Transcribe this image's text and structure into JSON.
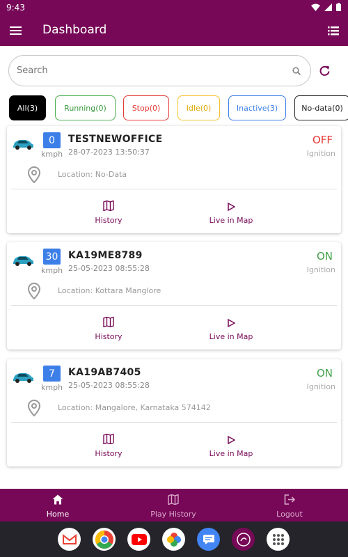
{
  "status": {
    "time": "9:43"
  },
  "appbar": {
    "title": "Dashboard"
  },
  "search": {
    "placeholder": "Search"
  },
  "filters": [
    {
      "label": "All(3)"
    },
    {
      "label": "Running(0)"
    },
    {
      "label": "Stop(0)"
    },
    {
      "label": "Idle(0)"
    },
    {
      "label": "Inactive(3)"
    },
    {
      "label": "No-data(0)"
    }
  ],
  "colors": {
    "brand": "#770857",
    "speed_badge": "#3d7fe8",
    "off": "#e53935",
    "on": "#43a047"
  },
  "vehicles": [
    {
      "speed": "0",
      "unit": "kmph",
      "name": "TESTNEWOFFICE",
      "datetime": "28-07-2023 13:50:37",
      "ignition": "OFF",
      "ignition_label": "Ignition",
      "location": "Location: No-Data",
      "history_label": "History",
      "live_label": "Live in Map"
    },
    {
      "speed": "30",
      "unit": "kmph",
      "name": "KA19ME8789",
      "datetime": "25-05-2023 08:55:28",
      "ignition": "ON",
      "ignition_label": "Ignition",
      "location": "Location: Kottara Manglore",
      "history_label": "History",
      "live_label": "Live in Map"
    },
    {
      "speed": "7",
      "unit": "kmph",
      "name": "KA19AB7405",
      "datetime": "25-05-2023 08:55:28",
      "ignition": "ON",
      "ignition_label": "Ignition",
      "location": "Location: Mangalore, Karnataka 574142",
      "history_label": "History",
      "live_label": "Live in Map"
    }
  ],
  "bottom_nav": [
    {
      "label": "Home",
      "icon": "home-icon"
    },
    {
      "label": "Play History",
      "icon": "map-icon"
    },
    {
      "label": "Logout",
      "icon": "logout-icon"
    }
  ],
  "dock_apps": [
    "gmail-icon",
    "chrome-icon",
    "youtube-icon",
    "photos-icon",
    "messages-icon",
    "tracking-app-icon",
    "app-drawer-icon"
  ]
}
